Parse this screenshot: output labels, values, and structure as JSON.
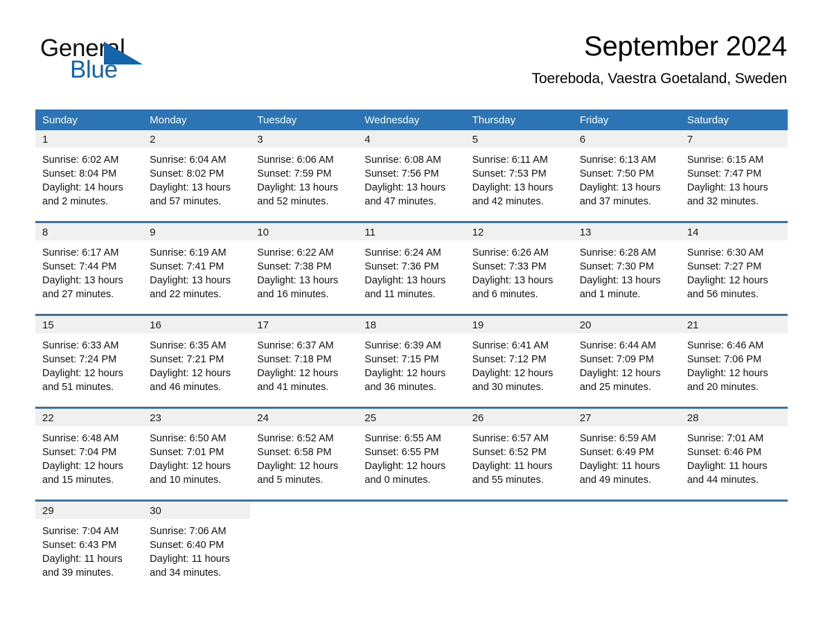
{
  "brand": {
    "name_part1": "General",
    "name_part2": "Blue",
    "triangle_icon": "blue-triangle-icon",
    "accent_color": "#1464aa"
  },
  "header": {
    "title": "September 2024",
    "location": "Toereboda, Vaestra Goetaland, Sweden"
  },
  "theme": {
    "header_blue": "#2d74b5",
    "day_strip_gray": "#f0f0f0",
    "text_color": "#111111"
  },
  "calendar": {
    "weekdays": [
      "Sunday",
      "Monday",
      "Tuesday",
      "Wednesday",
      "Thursday",
      "Friday",
      "Saturday"
    ],
    "weeks": [
      [
        {
          "day": "1",
          "sunrise": "Sunrise: 6:02 AM",
          "sunset": "Sunset: 8:04 PM",
          "daylight_line1": "Daylight: 14 hours",
          "daylight_line2": "and 2 minutes."
        },
        {
          "day": "2",
          "sunrise": "Sunrise: 6:04 AM",
          "sunset": "Sunset: 8:02 PM",
          "daylight_line1": "Daylight: 13 hours",
          "daylight_line2": "and 57 minutes."
        },
        {
          "day": "3",
          "sunrise": "Sunrise: 6:06 AM",
          "sunset": "Sunset: 7:59 PM",
          "daylight_line1": "Daylight: 13 hours",
          "daylight_line2": "and 52 minutes."
        },
        {
          "day": "4",
          "sunrise": "Sunrise: 6:08 AM",
          "sunset": "Sunset: 7:56 PM",
          "daylight_line1": "Daylight: 13 hours",
          "daylight_line2": "and 47 minutes."
        },
        {
          "day": "5",
          "sunrise": "Sunrise: 6:11 AM",
          "sunset": "Sunset: 7:53 PM",
          "daylight_line1": "Daylight: 13 hours",
          "daylight_line2": "and 42 minutes."
        },
        {
          "day": "6",
          "sunrise": "Sunrise: 6:13 AM",
          "sunset": "Sunset: 7:50 PM",
          "daylight_line1": "Daylight: 13 hours",
          "daylight_line2": "and 37 minutes."
        },
        {
          "day": "7",
          "sunrise": "Sunrise: 6:15 AM",
          "sunset": "Sunset: 7:47 PM",
          "daylight_line1": "Daylight: 13 hours",
          "daylight_line2": "and 32 minutes."
        }
      ],
      [
        {
          "day": "8",
          "sunrise": "Sunrise: 6:17 AM",
          "sunset": "Sunset: 7:44 PM",
          "daylight_line1": "Daylight: 13 hours",
          "daylight_line2": "and 27 minutes."
        },
        {
          "day": "9",
          "sunrise": "Sunrise: 6:19 AM",
          "sunset": "Sunset: 7:41 PM",
          "daylight_line1": "Daylight: 13 hours",
          "daylight_line2": "and 22 minutes."
        },
        {
          "day": "10",
          "sunrise": "Sunrise: 6:22 AM",
          "sunset": "Sunset: 7:38 PM",
          "daylight_line1": "Daylight: 13 hours",
          "daylight_line2": "and 16 minutes."
        },
        {
          "day": "11",
          "sunrise": "Sunrise: 6:24 AM",
          "sunset": "Sunset: 7:36 PM",
          "daylight_line1": "Daylight: 13 hours",
          "daylight_line2": "and 11 minutes."
        },
        {
          "day": "12",
          "sunrise": "Sunrise: 6:26 AM",
          "sunset": "Sunset: 7:33 PM",
          "daylight_line1": "Daylight: 13 hours",
          "daylight_line2": "and 6 minutes."
        },
        {
          "day": "13",
          "sunrise": "Sunrise: 6:28 AM",
          "sunset": "Sunset: 7:30 PM",
          "daylight_line1": "Daylight: 13 hours",
          "daylight_line2": "and 1 minute."
        },
        {
          "day": "14",
          "sunrise": "Sunrise: 6:30 AM",
          "sunset": "Sunset: 7:27 PM",
          "daylight_line1": "Daylight: 12 hours",
          "daylight_line2": "and 56 minutes."
        }
      ],
      [
        {
          "day": "15",
          "sunrise": "Sunrise: 6:33 AM",
          "sunset": "Sunset: 7:24 PM",
          "daylight_line1": "Daylight: 12 hours",
          "daylight_line2": "and 51 minutes."
        },
        {
          "day": "16",
          "sunrise": "Sunrise: 6:35 AM",
          "sunset": "Sunset: 7:21 PM",
          "daylight_line1": "Daylight: 12 hours",
          "daylight_line2": "and 46 minutes."
        },
        {
          "day": "17",
          "sunrise": "Sunrise: 6:37 AM",
          "sunset": "Sunset: 7:18 PM",
          "daylight_line1": "Daylight: 12 hours",
          "daylight_line2": "and 41 minutes."
        },
        {
          "day": "18",
          "sunrise": "Sunrise: 6:39 AM",
          "sunset": "Sunset: 7:15 PM",
          "daylight_line1": "Daylight: 12 hours",
          "daylight_line2": "and 36 minutes."
        },
        {
          "day": "19",
          "sunrise": "Sunrise: 6:41 AM",
          "sunset": "Sunset: 7:12 PM",
          "daylight_line1": "Daylight: 12 hours",
          "daylight_line2": "and 30 minutes."
        },
        {
          "day": "20",
          "sunrise": "Sunrise: 6:44 AM",
          "sunset": "Sunset: 7:09 PM",
          "daylight_line1": "Daylight: 12 hours",
          "daylight_line2": "and 25 minutes."
        },
        {
          "day": "21",
          "sunrise": "Sunrise: 6:46 AM",
          "sunset": "Sunset: 7:06 PM",
          "daylight_line1": "Daylight: 12 hours",
          "daylight_line2": "and 20 minutes."
        }
      ],
      [
        {
          "day": "22",
          "sunrise": "Sunrise: 6:48 AM",
          "sunset": "Sunset: 7:04 PM",
          "daylight_line1": "Daylight: 12 hours",
          "daylight_line2": "and 15 minutes."
        },
        {
          "day": "23",
          "sunrise": "Sunrise: 6:50 AM",
          "sunset": "Sunset: 7:01 PM",
          "daylight_line1": "Daylight: 12 hours",
          "daylight_line2": "and 10 minutes."
        },
        {
          "day": "24",
          "sunrise": "Sunrise: 6:52 AM",
          "sunset": "Sunset: 6:58 PM",
          "daylight_line1": "Daylight: 12 hours",
          "daylight_line2": "and 5 minutes."
        },
        {
          "day": "25",
          "sunrise": "Sunrise: 6:55 AM",
          "sunset": "Sunset: 6:55 PM",
          "daylight_line1": "Daylight: 12 hours",
          "daylight_line2": "and 0 minutes."
        },
        {
          "day": "26",
          "sunrise": "Sunrise: 6:57 AM",
          "sunset": "Sunset: 6:52 PM",
          "daylight_line1": "Daylight: 11 hours",
          "daylight_line2": "and 55 minutes."
        },
        {
          "day": "27",
          "sunrise": "Sunrise: 6:59 AM",
          "sunset": "Sunset: 6:49 PM",
          "daylight_line1": "Daylight: 11 hours",
          "daylight_line2": "and 49 minutes."
        },
        {
          "day": "28",
          "sunrise": "Sunrise: 7:01 AM",
          "sunset": "Sunset: 6:46 PM",
          "daylight_line1": "Daylight: 11 hours",
          "daylight_line2": "and 44 minutes."
        }
      ],
      [
        {
          "day": "29",
          "sunrise": "Sunrise: 7:04 AM",
          "sunset": "Sunset: 6:43 PM",
          "daylight_line1": "Daylight: 11 hours",
          "daylight_line2": "and 39 minutes."
        },
        {
          "day": "30",
          "sunrise": "Sunrise: 7:06 AM",
          "sunset": "Sunset: 6:40 PM",
          "daylight_line1": "Daylight: 11 hours",
          "daylight_line2": "and 34 minutes."
        },
        {
          "day": "",
          "sunrise": "",
          "sunset": "",
          "daylight_line1": "",
          "daylight_line2": "",
          "blank": true
        },
        {
          "day": "",
          "sunrise": "",
          "sunset": "",
          "daylight_line1": "",
          "daylight_line2": "",
          "blank": true
        },
        {
          "day": "",
          "sunrise": "",
          "sunset": "",
          "daylight_line1": "",
          "daylight_line2": "",
          "blank": true
        },
        {
          "day": "",
          "sunrise": "",
          "sunset": "",
          "daylight_line1": "",
          "daylight_line2": "",
          "blank": true
        },
        {
          "day": "",
          "sunrise": "",
          "sunset": "",
          "daylight_line1": "",
          "daylight_line2": "",
          "blank": true
        }
      ]
    ]
  }
}
